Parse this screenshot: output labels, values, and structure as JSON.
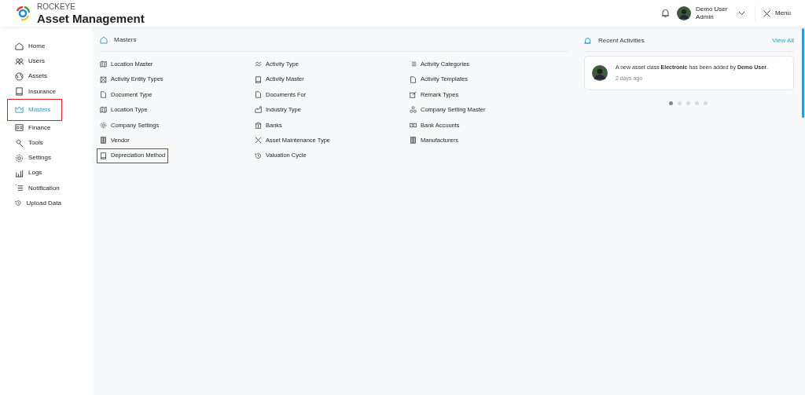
{
  "header": {
    "brand": "ROCKEYE",
    "title": "Asset Management",
    "user_name": "Demo User",
    "user_role": "Admin",
    "menu_label": "Menu"
  },
  "sidebar": {
    "items": [
      {
        "label": "Home",
        "selected": false,
        "highlighted": false
      },
      {
        "label": "Users",
        "selected": false,
        "highlighted": false
      },
      {
        "label": "Assets",
        "selected": false,
        "highlighted": false
      },
      {
        "label": "Insurance",
        "selected": false,
        "highlighted": false
      },
      {
        "label": "Masters",
        "selected": true,
        "highlighted": true
      },
      {
        "label": "Finance",
        "selected": false,
        "highlighted": false
      },
      {
        "label": "Tools",
        "selected": false,
        "highlighted": false
      },
      {
        "label": "Settings",
        "selected": false,
        "highlighted": false
      },
      {
        "label": "Logs",
        "selected": false,
        "highlighted": false
      },
      {
        "label": "Notification",
        "selected": false,
        "highlighted": false
      },
      {
        "label": "Upload Data",
        "selected": false,
        "highlighted": false
      }
    ]
  },
  "masters": {
    "title": "Masters",
    "columns": [
      [
        {
          "label": "Location Master",
          "highlighted": false
        },
        {
          "label": "Activity Entity Types",
          "highlighted": false
        },
        {
          "label": "Document Type",
          "highlighted": false
        },
        {
          "label": "Location Type",
          "highlighted": false
        },
        {
          "label": "Company Settings",
          "highlighted": false
        },
        {
          "label": "Vendor",
          "highlighted": false
        },
        {
          "label": "Depreciation Method",
          "highlighted": true
        }
      ],
      [
        {
          "label": "Activity Type",
          "highlighted": false
        },
        {
          "label": "Activity Master",
          "highlighted": false
        },
        {
          "label": "Documents For",
          "highlighted": false
        },
        {
          "label": "Industry Type",
          "highlighted": false
        },
        {
          "label": "Banks",
          "highlighted": false
        },
        {
          "label": "Asset Maintenance Type",
          "highlighted": false
        },
        {
          "label": "Valuation Cycle",
          "highlighted": false
        }
      ],
      [
        {
          "label": "Activity Categories",
          "highlighted": false
        },
        {
          "label": "Activity Templates",
          "highlighted": false
        },
        {
          "label": "Remark Types",
          "highlighted": false
        },
        {
          "label": "Company Setting Master",
          "highlighted": false
        },
        {
          "label": "Bank Accounts",
          "highlighted": false
        },
        {
          "label": "Manufacturers",
          "highlighted": false
        }
      ]
    ]
  },
  "recent_activities": {
    "title": "Recent Activities",
    "view_all": "View All",
    "items": [
      {
        "text": "A new asset class **Electronic** has been added by **Demo User**.",
        "time": "2 days ago"
      }
    ],
    "pager": [
      {
        "selected": true
      },
      {
        "selected": false
      },
      {
        "selected": false
      },
      {
        "selected": false
      },
      {
        "selected": false
      }
    ]
  }
}
